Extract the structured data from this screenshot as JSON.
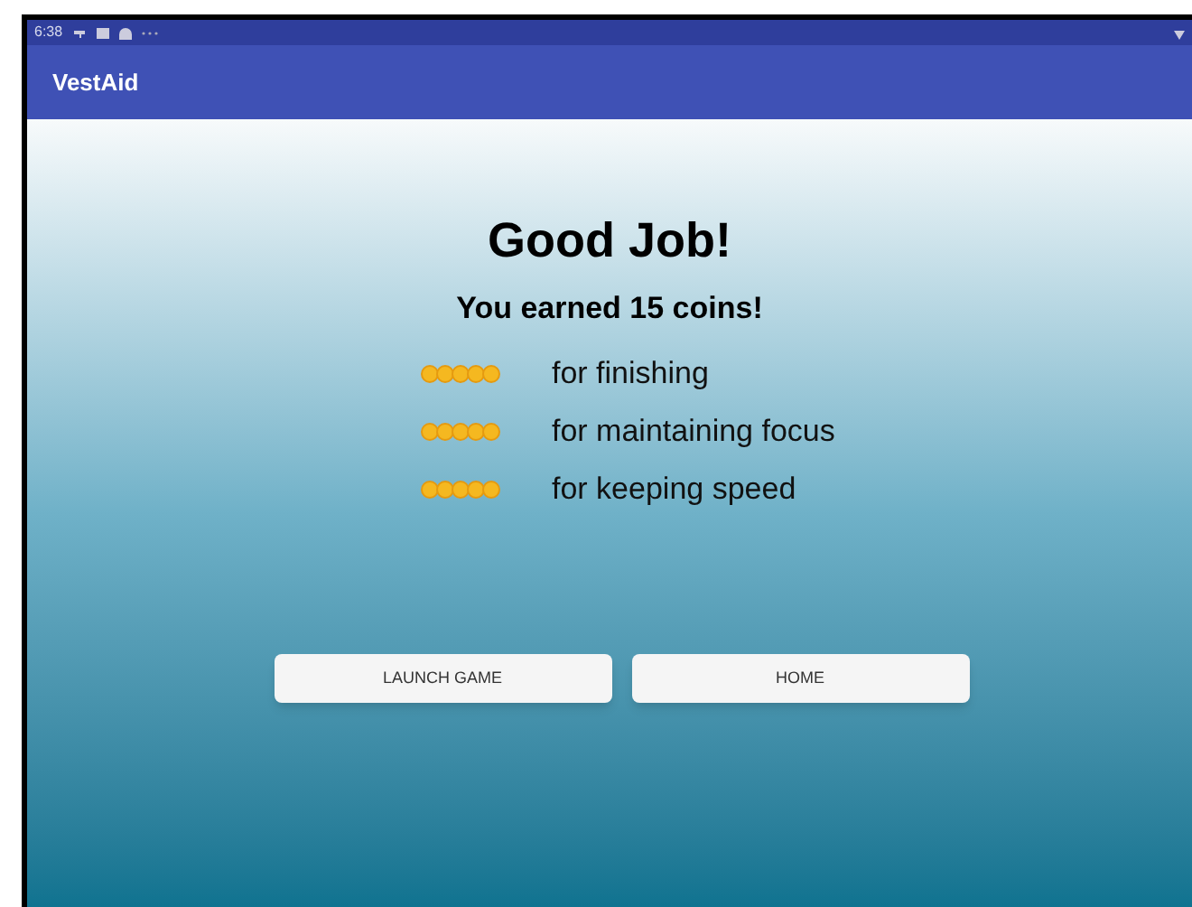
{
  "status_bar": {
    "time": "6:38"
  },
  "app_bar": {
    "title": "VestAid"
  },
  "heading": "Good Job!",
  "subheading": "You earned 15 coins!",
  "rewards": [
    {
      "label": "for finishing"
    },
    {
      "label": "for maintaining focus"
    },
    {
      "label": "for keeping speed"
    }
  ],
  "buttons": [
    {
      "label": "LAUNCH GAME"
    },
    {
      "label": "HOME"
    }
  ]
}
